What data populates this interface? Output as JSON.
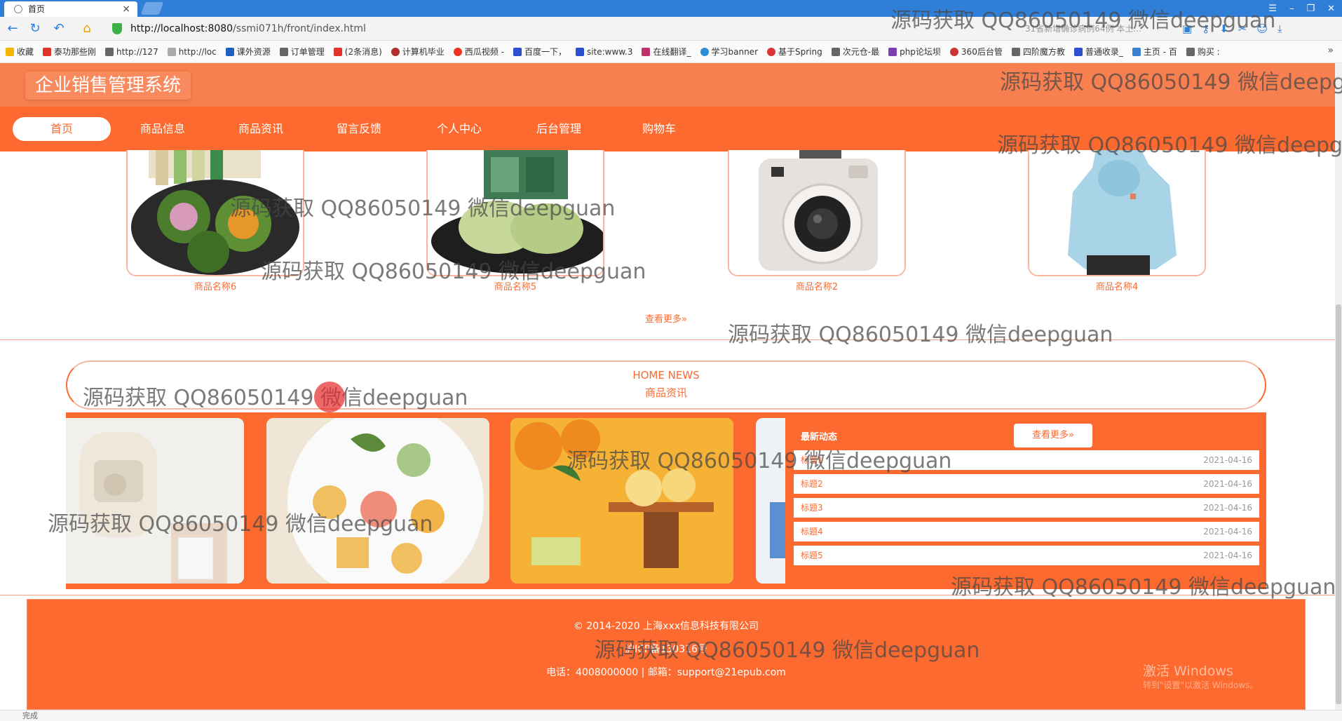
{
  "browser": {
    "tab_title": "首页",
    "tab_close": "×",
    "url_host": "http://localhost:8080",
    "url_path": "/ssmi071h/front/index.html",
    "search_hint": "31省新增确诊病例64例 本土...",
    "bookmarks": [
      "收藏",
      "泰功那些刚",
      "http://127",
      "http://loc",
      "课外资源",
      "订单管理",
      "(2条消息)",
      "计算机毕业",
      "西瓜视频 -",
      "百度一下，",
      "site:www.3",
      "在线翻译_",
      "学习banner",
      "基于Spring",
      "次元仓-最",
      "php论坛坝",
      "360后台管",
      "四阶魔方教",
      "普通收录_",
      "主页 - 百",
      "购买 :"
    ],
    "bookmark_more": "»",
    "status_text": "完成"
  },
  "site": {
    "title": "企业销售管理系统",
    "nav": [
      "首页",
      "商品信息",
      "商品资讯",
      "留言反馈",
      "个人中心",
      "后台管理",
      "购物车"
    ]
  },
  "products": [
    {
      "name": "商品名称6"
    },
    {
      "name": "商品名称5"
    },
    {
      "name": "商品名称2"
    },
    {
      "name": "商品名称4"
    }
  ],
  "products_more": "查看更多»",
  "news": {
    "title_en": "HOME NEWS",
    "title_cn": "商品资讯",
    "latest_title": "最新动态",
    "latest_more": "查看更多»",
    "items": [
      {
        "title": "标题1",
        "date": "2021-04-16"
      },
      {
        "title": "标题2",
        "date": "2021-04-16"
      },
      {
        "title": "标题3",
        "date": "2021-04-16"
      },
      {
        "title": "标题4",
        "date": "2021-04-16"
      },
      {
        "title": "标题5",
        "date": "2021-04-16"
      }
    ]
  },
  "footer": {
    "copyright": "© 2014-2020 上海xxx信息科技有限公司",
    "icp": "沪ICP备130316号",
    "contact": "电话：4008000000 | 邮箱：support@21epub.com"
  },
  "overlay": {
    "watermark": "源码获取 QQ86050149 微信deepguan",
    "windows_activate": "激活 Windows",
    "windows_activate_sub": "转到\"设置\"以激活 Windows。"
  },
  "colors": {
    "brand_orange": "#fd6a2f",
    "header_orange": "#f87f4f",
    "browser_blue": "#2f7fd8"
  }
}
